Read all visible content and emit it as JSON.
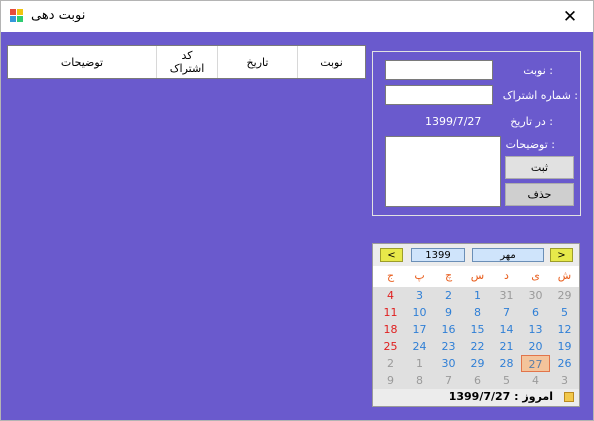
{
  "window": {
    "title": "نوبت دهی",
    "close_glyph": "✕"
  },
  "grid": {
    "headers": [
      "نوبت",
      "تاریخ",
      "کد\nاشتراک",
      "توضیحات"
    ]
  },
  "form": {
    "turn_label": "نوبت :",
    "turn_value": "",
    "subscription_label": "شماره اشتراک :",
    "subscription_value": "",
    "date_label": "در تاریخ :",
    "date_value": "1399/7/27",
    "description_label": "توضیحات :",
    "description_value": "",
    "submit_label": "ثبت",
    "delete_label": "حذف"
  },
  "calendar": {
    "prev_label": "<",
    "next_label": ">",
    "year": "1399",
    "month": "مهر",
    "day_names": [
      "ش",
      "ی",
      "د",
      "س",
      "چ",
      "پ",
      "ج"
    ],
    "weeks": [
      [
        {
          "t": "29",
          "c": "gray"
        },
        {
          "t": "30",
          "c": "gray"
        },
        {
          "t": "31",
          "c": "gray"
        },
        {
          "t": "1",
          "c": "blue"
        },
        {
          "t": "2",
          "c": "blue"
        },
        {
          "t": "3",
          "c": "blue"
        },
        {
          "t": "4",
          "c": "red"
        }
      ],
      [
        {
          "t": "5",
          "c": "blue"
        },
        {
          "t": "6",
          "c": "blue"
        },
        {
          "t": "7",
          "c": "blue"
        },
        {
          "t": "8",
          "c": "blue"
        },
        {
          "t": "9",
          "c": "blue"
        },
        {
          "t": "10",
          "c": "blue"
        },
        {
          "t": "11",
          "c": "red"
        }
      ],
      [
        {
          "t": "12",
          "c": "blue"
        },
        {
          "t": "13",
          "c": "blue"
        },
        {
          "t": "14",
          "c": "blue"
        },
        {
          "t": "15",
          "c": "blue"
        },
        {
          "t": "16",
          "c": "blue"
        },
        {
          "t": "17",
          "c": "blue"
        },
        {
          "t": "18",
          "c": "red"
        }
      ],
      [
        {
          "t": "19",
          "c": "blue"
        },
        {
          "t": "20",
          "c": "blue"
        },
        {
          "t": "21",
          "c": "blue"
        },
        {
          "t": "22",
          "c": "blue"
        },
        {
          "t": "23",
          "c": "blue"
        },
        {
          "t": "24",
          "c": "blue"
        },
        {
          "t": "25",
          "c": "red"
        }
      ],
      [
        {
          "t": "26",
          "c": "blue"
        },
        {
          "t": "27",
          "c": "today"
        },
        {
          "t": "28",
          "c": "blue"
        },
        {
          "t": "29",
          "c": "blue"
        },
        {
          "t": "30",
          "c": "blue"
        },
        {
          "t": "1",
          "c": "gray"
        },
        {
          "t": "2",
          "c": "gray"
        }
      ],
      [
        {
          "t": "3",
          "c": "gray"
        },
        {
          "t": "4",
          "c": "gray"
        },
        {
          "t": "5",
          "c": "gray"
        },
        {
          "t": "6",
          "c": "gray"
        },
        {
          "t": "7",
          "c": "gray"
        },
        {
          "t": "8",
          "c": "gray"
        },
        {
          "t": "9",
          "c": "gray"
        }
      ]
    ],
    "today_text": "امروز : 1399/7/27"
  },
  "colors": {
    "client_bg": "#6a5acd",
    "weekend": "#e02020",
    "weekday": "#2f7fd6"
  }
}
